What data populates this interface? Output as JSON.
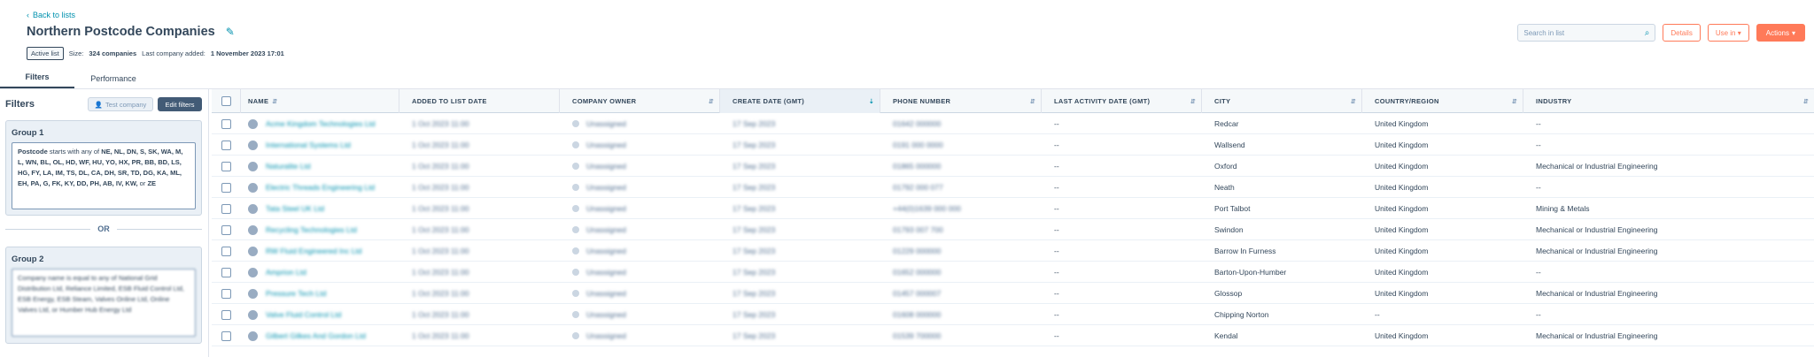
{
  "header": {
    "back_link": "Back to lists",
    "title": "Northern Postcode Companies",
    "status_badge": "Active list",
    "size_label": "Size:",
    "size_value": "324 companies",
    "last_added_label": "Last company added:",
    "last_added_value": "1 November 2023 17:01"
  },
  "toolbar": {
    "search_placeholder": "Search in list",
    "details": "Details",
    "use_in": "Use in",
    "actions": "Actions"
  },
  "tabs": [
    "Filters",
    "Performance"
  ],
  "sidebar": {
    "title": "Filters",
    "test_button": "Test company",
    "edit_button": "Edit filters",
    "group1": {
      "title": "Group 1",
      "field": "Postcode",
      "operator": "starts with any of",
      "values": "NE, NL, DN, S, SK, WA, M, L, WN, BL, OL, HD, WF, HU, YO, HX, PR, BB, BD, LS, HG, FY, LA, IM, TS, DL, CA, DH, SR, TD, DG, KA, ML, EH, PA, G, FK, KY, DD, PH, AB, IV, KW,",
      "or_word": "or",
      "last_value": "ZE"
    },
    "or_divider": "OR",
    "group2": {
      "title": "Group 2",
      "blurred_text": "Company name is equal to any of National Grid Distribution Ltd, Reliance Limited, ESB Fluid Control Ltd, ESB Energy, ESB Steam, Valves Online Ltd, Online Valves Ltd, or Humber Hub Energy Ltd"
    }
  },
  "table": {
    "columns": [
      "NAME",
      "ADDED TO LIST DATE",
      "COMPANY OWNER",
      "CREATE DATE (GMT)",
      "PHONE NUMBER",
      "LAST ACTIVITY DATE (GMT)",
      "CITY",
      "COUNTRY/REGION",
      "INDUSTRY"
    ],
    "rows": [
      {
        "name": "Acme Kingdom Technologies Ltd",
        "added": "1 Oct 2023 11:00",
        "owner": "Unassigned",
        "created": "17 Sep 2023",
        "phone": "01642 000000",
        "last_activity": "--",
        "city": "Redcar",
        "country": "United Kingdom",
        "industry": "--"
      },
      {
        "name": "International Systems Ltd",
        "added": "1 Oct 2023 11:00",
        "owner": "Unassigned",
        "created": "17 Sep 2023",
        "phone": "0191 000 0000",
        "last_activity": "--",
        "city": "Wallsend",
        "country": "United Kingdom",
        "industry": "--"
      },
      {
        "name": "Naturalite Ltd",
        "added": "1 Oct 2023 11:00",
        "owner": "Unassigned",
        "created": "17 Sep 2023",
        "phone": "01865 000000",
        "last_activity": "--",
        "city": "Oxford",
        "country": "United Kingdom",
        "industry": "Mechanical or Industrial Engineering"
      },
      {
        "name": "Electric Threads Engineering Ltd",
        "added": "1 Oct 2023 11:00",
        "owner": "Unassigned",
        "created": "17 Sep 2023",
        "phone": "01792 000 077",
        "last_activity": "--",
        "city": "Neath",
        "country": "United Kingdom",
        "industry": "--"
      },
      {
        "name": "Tata Steel UK Ltd",
        "added": "1 Oct 2023 11:00",
        "owner": "Unassigned",
        "created": "17 Sep 2023",
        "phone": "+44(0)1639 000 000",
        "last_activity": "--",
        "city": "Port Talbot",
        "country": "United Kingdom",
        "industry": "Mining & Metals"
      },
      {
        "name": "Recycling Technologies Ltd",
        "added": "1 Oct 2023 11:00",
        "owner": "Unassigned",
        "created": "17 Sep 2023",
        "phone": "01793 007 700",
        "last_activity": "--",
        "city": "Swindon",
        "country": "United Kingdom",
        "industry": "Mechanical or Industrial Engineering"
      },
      {
        "name": "RW Fluid Engineered Inc Ltd",
        "added": "1 Oct 2023 11:00",
        "owner": "Unassigned",
        "created": "17 Sep 2023",
        "phone": "01229 000000",
        "last_activity": "--",
        "city": "Barrow In Furness",
        "country": "United Kingdom",
        "industry": "Mechanical or Industrial Engineering"
      },
      {
        "name": "Amprion Ltd",
        "added": "1 Oct 2023 11:00",
        "owner": "Unassigned",
        "created": "17 Sep 2023",
        "phone": "01652 000000",
        "last_activity": "--",
        "city": "Barton-Upon-Humber",
        "country": "United Kingdom",
        "industry": "--"
      },
      {
        "name": "Pressure Tech Ltd",
        "added": "1 Oct 2023 11:00",
        "owner": "Unassigned",
        "created": "17 Sep 2023",
        "phone": "01457 000007",
        "last_activity": "--",
        "city": "Glossop",
        "country": "United Kingdom",
        "industry": "Mechanical or Industrial Engineering"
      },
      {
        "name": "Valve Fluid Control Ltd",
        "added": "1 Oct 2023 11:00",
        "owner": "Unassigned",
        "created": "17 Sep 2023",
        "phone": "01608 000000",
        "last_activity": "--",
        "city": "Chipping Norton",
        "country": "--",
        "industry": "--"
      },
      {
        "name": "Gilbert Gilkes And Gordon Ltd",
        "added": "1 Oct 2023 11:00",
        "owner": "Unassigned",
        "created": "17 Sep 2023",
        "phone": "01539 700000",
        "last_activity": "--",
        "city": "Kendal",
        "country": "United Kingdom",
        "industry": "Mechanical or Industrial Engineering"
      }
    ]
  },
  "colors": {
    "accent": "#ff7a59",
    "link": "#0091ae",
    "text": "#33475b",
    "edit_button": "#425b76"
  },
  "icons": [
    "chevron-left-icon",
    "pencil-icon",
    "search-icon",
    "caret-down-icon",
    "person-icon",
    "sort-icon"
  ]
}
